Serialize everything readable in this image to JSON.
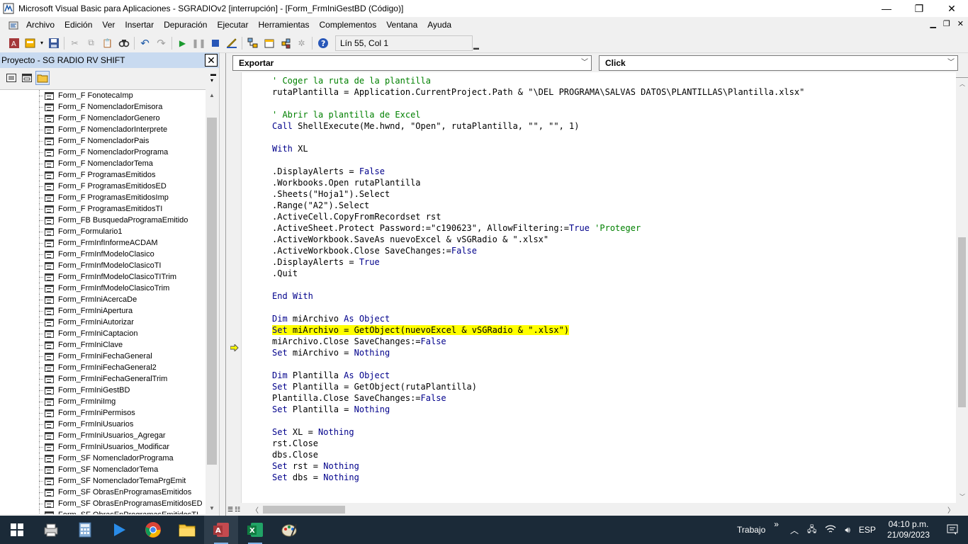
{
  "window": {
    "title": "Microsoft Visual Basic para Aplicaciones - SGRADIOv2 [interrupción] - [Form_FrmIniGestBD (Código)]",
    "minimize": "—",
    "restore": "❐",
    "close": "✕"
  },
  "menu": {
    "items": [
      "Archivo",
      "Edición",
      "Ver",
      "Insertar",
      "Depuración",
      "Ejecutar",
      "Herramientas",
      "Complementos",
      "Ventana",
      "Ayuda"
    ]
  },
  "toolbar": {
    "position": "Lín 55, Col 1"
  },
  "project": {
    "title": "Proyecto - SG RADIO RV SHIFT",
    "close": "✕",
    "tree_items": [
      "Form_F FonotecaImp",
      "Form_F NomencladorEmisora",
      "Form_F NomencladorGenero",
      "Form_F NomencladorInterprete",
      "Form_F NomencladorPais",
      "Form_F NomencladorPrograma",
      "Form_F NomencladorTema",
      "Form_F ProgramasEmitidos",
      "Form_F ProgramasEmitidosED",
      "Form_F ProgramasEmitidosImp",
      "Form_F ProgramasEmitidosTI",
      "Form_FB BusquedaProgramaEmitido",
      "Form_Formulario1",
      "Form_FrmInfInformeACDAM",
      "Form_FrmInfModeloClasico",
      "Form_FrmInfModeloClasicoTI",
      "Form_FrmInfModeloClasicoTITrim",
      "Form_FrmInfModeloClasicoTrim",
      "Form_FrmIniAcercaDe",
      "Form_FrmIniApertura",
      "Form_FrmIniAutorizar",
      "Form_FrmIniCaptacion",
      "Form_FrmIniClave",
      "Form_FrmIniFechaGeneral",
      "Form_FrmIniFechaGeneral2",
      "Form_FrmIniFechaGeneralTrim",
      "Form_FrmIniGestBD",
      "Form_FrmIniImg",
      "Form_FrmIniPermisos",
      "Form_FrmIniUsuarios",
      "Form_FrmIniUsuarios_Agregar",
      "Form_FrmIniUsuarios_Modificar",
      "Form_SF NomencladorPrograma",
      "Form_SF NomencladorTema",
      "Form_SF NomencladorTemaPrgEmit",
      "Form_SF ObrasEnProgramasEmitidos",
      "Form_SF ObrasEnProgramasEmitidosED",
      "Form_SF ObrasEnProgramasEmitidosTI"
    ]
  },
  "code": {
    "object_combo": "Exportar",
    "proc_combo": "Click",
    "lines": [
      [
        {
          "t": "' Coger la ruta de la plantilla",
          "c": "cm"
        }
      ],
      [
        {
          "t": "rutaPlantilla = Application.CurrentProject.Path & \"\\DEL PROGRAMA\\SALVAS DATOS\\PLANTILLAS\\Plantilla.xlsx\""
        }
      ],
      [],
      [
        {
          "t": "' Abrir la plantilla de Excel",
          "c": "cm"
        }
      ],
      [
        {
          "t": "Call",
          "c": "kw"
        },
        {
          "t": " ShellExecute(Me.hwnd, \"Open\", rutaPlantilla, \"\", \"\", 1)"
        }
      ],
      [],
      [
        {
          "t": "With",
          "c": "kw"
        },
        {
          "t": " XL"
        }
      ],
      [],
      [
        {
          "t": ".DisplayAlerts = "
        },
        {
          "t": "False",
          "c": "kw"
        }
      ],
      [
        {
          "t": ".Workbooks.Open rutaPlantilla"
        }
      ],
      [
        {
          "t": ".Sheets(\"Hoja1\").Select"
        }
      ],
      [
        {
          "t": ".Range(\"A2\").Select"
        }
      ],
      [
        {
          "t": ".ActiveCell.CopyFromRecordset rst"
        }
      ],
      [
        {
          "t": ".ActiveSheet.Protect Password:=\"c190623\", AllowFiltering:="
        },
        {
          "t": "True",
          "c": "kw"
        },
        {
          "t": " 'Proteger",
          "c": "cm"
        }
      ],
      [
        {
          "t": ".ActiveWorkbook.SaveAs nuevoExcel & vSGRadio & \".xlsx\""
        }
      ],
      [
        {
          "t": ".ActiveWorkbook.Close SaveChanges:="
        },
        {
          "t": "False",
          "c": "kw"
        }
      ],
      [
        {
          "t": ".DisplayAlerts = "
        },
        {
          "t": "True",
          "c": "kw"
        }
      ],
      [
        {
          "t": ".Quit"
        }
      ],
      [],
      [
        {
          "t": "End With",
          "c": "kw"
        }
      ],
      [],
      [
        {
          "t": "Dim",
          "c": "kw"
        },
        {
          "t": " miArchivo "
        },
        {
          "t": "As Object",
          "c": "kw"
        }
      ],
      [
        {
          "t": "Set",
          "c": "kw"
        },
        {
          "t": " miArchivo = GetObject(nuevoExcel & vSGRadio & \".xlsx\")"
        }
      ],
      [
        {
          "t": "miArchivo.Close SaveChanges:="
        },
        {
          "t": "False",
          "c": "kw"
        }
      ],
      [
        {
          "t": "Set",
          "c": "kw"
        },
        {
          "t": " miArchivo = "
        },
        {
          "t": "Nothing",
          "c": "kw"
        }
      ],
      [],
      [
        {
          "t": "Dim",
          "c": "kw"
        },
        {
          "t": " Plantilla "
        },
        {
          "t": "As Object",
          "c": "kw"
        }
      ],
      [
        {
          "t": "Set",
          "c": "kw"
        },
        {
          "t": " Plantilla = GetObject(rutaPlantilla)"
        }
      ],
      [
        {
          "t": "Plantilla.Close SaveChanges:="
        },
        {
          "t": "False",
          "c": "kw"
        }
      ],
      [
        {
          "t": "Set",
          "c": "kw"
        },
        {
          "t": " Plantilla = "
        },
        {
          "t": "Nothing",
          "c": "kw"
        }
      ],
      [],
      [
        {
          "t": "Set",
          "c": "kw"
        },
        {
          "t": " XL = "
        },
        {
          "t": "Nothing",
          "c": "kw"
        }
      ],
      [
        {
          "t": "rst.Close"
        }
      ],
      [
        {
          "t": "dbs.Close"
        }
      ],
      [
        {
          "t": "Set",
          "c": "kw"
        },
        {
          "t": " rst = "
        },
        {
          "t": "Nothing",
          "c": "kw"
        }
      ],
      [
        {
          "t": "Set",
          "c": "kw"
        },
        {
          "t": " dbs = "
        },
        {
          "t": "Nothing",
          "c": "kw"
        }
      ]
    ],
    "highlighted_line": 22
  },
  "taskbar": {
    "tray_label": "Trabajo",
    "tray_chevron": "»",
    "language": "ESP",
    "time": "04:10 p.m.",
    "date": "21/09/2023"
  },
  "colors": {
    "keyword": "#00008b",
    "comment": "#008000",
    "highlight": "#ffff00",
    "taskbar": "#1b2a38"
  }
}
